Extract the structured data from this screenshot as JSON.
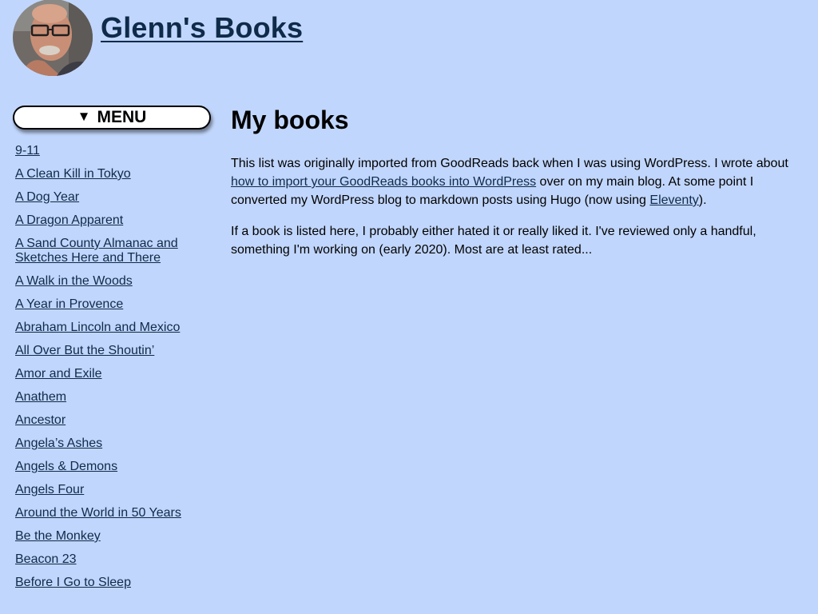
{
  "header": {
    "site_title": "Glenn's Books",
    "avatar_icon": "person-photo-icon"
  },
  "sidebar": {
    "menu_label": "MENU",
    "menu_icon": "triangle-down-icon",
    "books": [
      "9-11",
      "A Clean Kill in Tokyo",
      "A Dog Year",
      "A Dragon Apparent",
      "A Sand County Almanac and Sketches Here and There",
      "A Walk in the Woods",
      "A Year in Provence",
      "Abraham Lincoln and Mexico",
      "All Over But the Shoutin’",
      "Amor and Exile",
      "Anathem",
      "Ancestor",
      "Angela’s Ashes",
      "Angels & Demons",
      "Angels Four",
      "Around the World in 50 Years",
      "Be the Monkey",
      "Beacon 23",
      "Before I Go to Sleep"
    ]
  },
  "main": {
    "heading": "My books",
    "p1": {
      "text_a": "This list was originally imported from GoodReads back when I was using WordPress. I wrote about ",
      "link_a": "how to import your GoodReads books into WordPress",
      "text_b": " over on my main blog. At some point I converted my WordPress blog to markdown posts using Hugo (now using ",
      "link_b": "Eleventy",
      "text_c": ")."
    },
    "p2": "If a book is listed here, I probably either hated it or really liked it. I've reviewed only a handful, something I'm working on (early 2020). Most are at least rated..."
  },
  "colors": {
    "background": "#c1d6fc",
    "link": "#0f2b4a"
  }
}
